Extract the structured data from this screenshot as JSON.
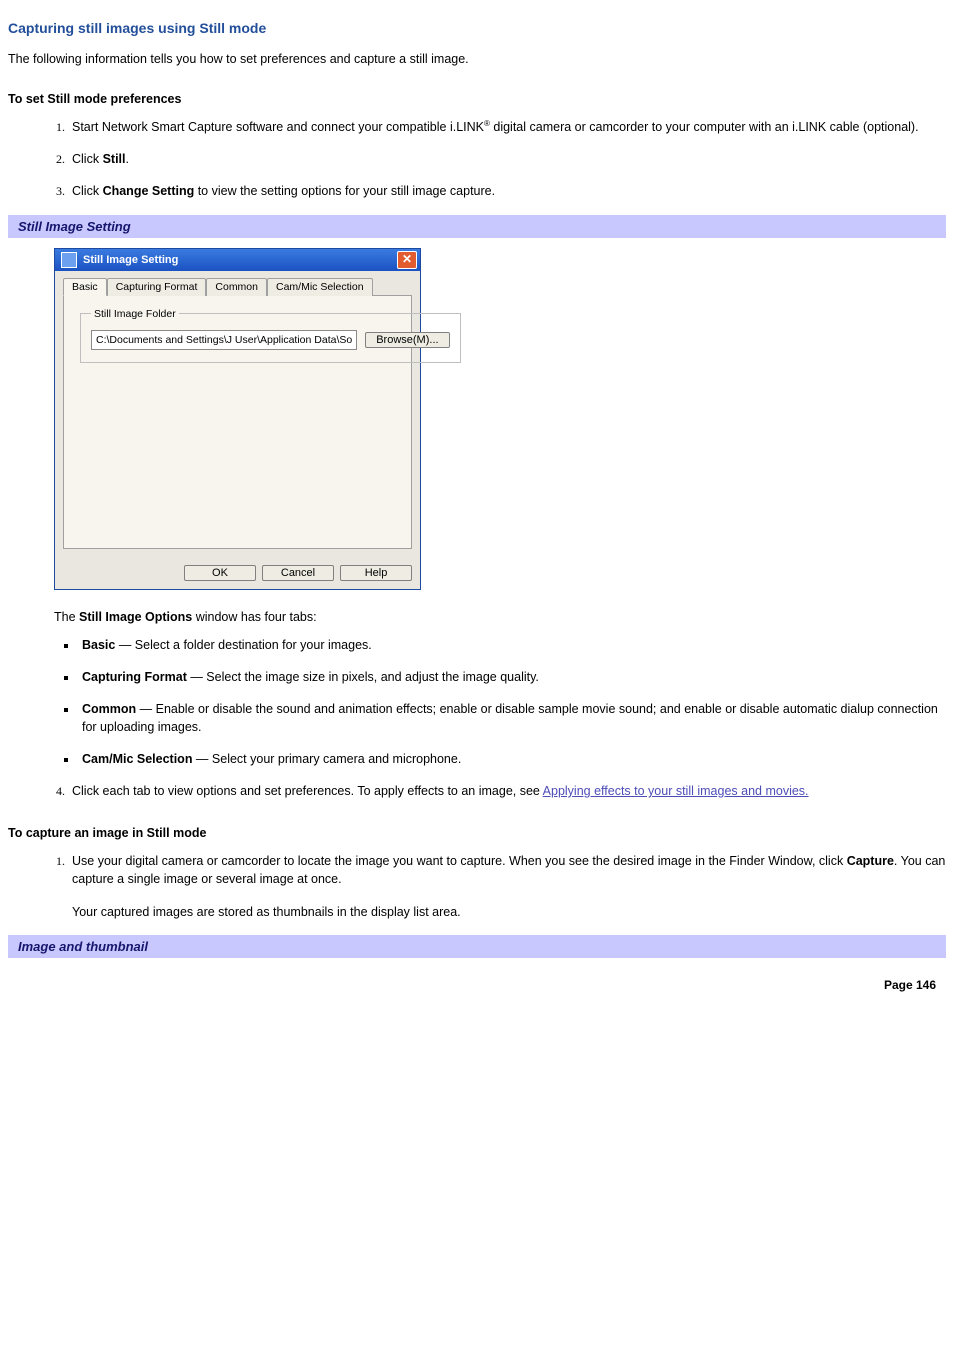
{
  "title": "Capturing still images using Still mode",
  "intro": "The following information tells you how to set preferences and capture a still image.",
  "section1_hdr": "To set Still mode preferences",
  "steps1": {
    "s1_a": "Start Network Smart Capture software and connect your compatible i.LINK",
    "s1_reg": "®",
    "s1_b": " digital camera or camcorder to your computer with an i.LINK cable (optional).",
    "s2_pre": "Click ",
    "s2_bold": "Still",
    "s2_post": ".",
    "s3_pre": "Click ",
    "s3_bold": "Change Setting",
    "s3_post": " to view the setting options for your still image capture."
  },
  "caption1": "Still Image Setting",
  "dialog": {
    "title": "Still Image Setting",
    "tabs": [
      "Basic",
      "Capturing Format",
      "Common",
      "Cam/Mic Selection"
    ],
    "folder_legend": "Still Image Folder",
    "path": "C:\\Documents and Settings\\J User\\Application Data\\So",
    "browse": "Browse(M)...",
    "ok": "OK",
    "cancel": "Cancel",
    "help": "Help"
  },
  "options_intro_pre": "The ",
  "options_intro_bold": "Still Image Options",
  "options_intro_post": " window has four tabs:",
  "bullets": {
    "b1_bold": "Basic",
    "b1_text": " — Select a folder destination for your images.",
    "b2_bold": "Capturing Format",
    "b2_text": " — Select the image size in pixels, and adjust the image quality.",
    "b3_bold": "Common",
    "b3_text": " — Enable or disable the sound and animation effects; enable or disable sample movie sound; and enable or disable automatic dialup connection for uploading images.",
    "b4_bold": "Cam/Mic Selection",
    "b4_text": " — Select your primary camera and microphone."
  },
  "step4_pre": "Click each tab to view options and set preferences. To apply effects to an image, see ",
  "step4_link": "Applying effects to your still images and movies.",
  "section2_hdr": "To capture an image in Still mode",
  "capture": {
    "s1_a": "Use your digital camera or camcorder to locate the image you want to capture. When you see the desired image in the Finder Window, click ",
    "s1_bold": "Capture",
    "s1_b": ". You can capture a single image or several image at once.",
    "s1_note": "Your captured images are stored as thumbnails in the display list area."
  },
  "caption2": "Image and thumbnail",
  "page_footer": "Page 146"
}
